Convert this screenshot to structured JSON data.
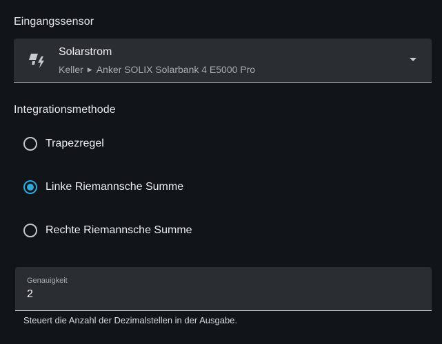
{
  "input_sensor": {
    "section_label": "Eingangssensor",
    "entity_name": "Solarstrom",
    "area": "Keller",
    "device": "Anker SOLIX Solarbank 4 E5000 Pro",
    "icon": "solar-power-icon"
  },
  "integration": {
    "section_label": "Integrationsmethode",
    "options": [
      {
        "label": "Trapezregel",
        "checked": false
      },
      {
        "label": "Linke Riemannsche Summe",
        "checked": true
      },
      {
        "label": "Rechte Riemannsche Summe",
        "checked": false
      }
    ]
  },
  "precision": {
    "label": "Genauigkeit",
    "value": "2",
    "helper": "Steuert die Anzahl der Dezimalstellen in der Ausgabe."
  },
  "colors": {
    "background": "#111418",
    "field_background": "#2a2d31",
    "accent": "#2ea8dd"
  }
}
